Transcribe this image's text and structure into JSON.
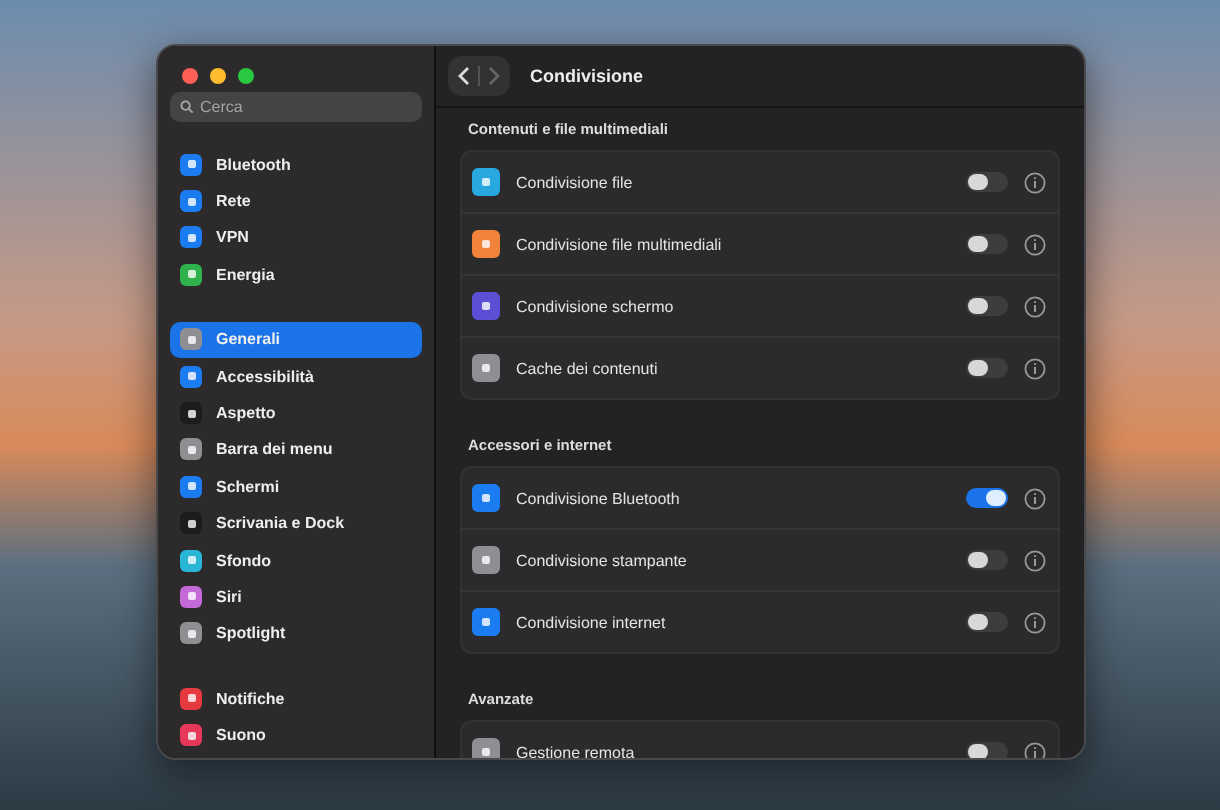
{
  "sidebar": {
    "search": {
      "placeholder": "Cerca"
    },
    "groups": [
      {
        "items": [
          {
            "label": "Bluetooth",
            "color": "#1a7cf0",
            "selected": false
          },
          {
            "label": "Rete",
            "color": "#1a7cf0",
            "selected": false
          },
          {
            "label": "VPN",
            "color": "#1a7cf0",
            "selected": false
          },
          {
            "label": "Energia",
            "color": "#2fb24c",
            "selected": false
          }
        ]
      },
      {
        "items": [
          {
            "label": "Generali",
            "color": "#8e8e93",
            "selected": true
          },
          {
            "label": "Accessibilità",
            "color": "#1a7cf0",
            "selected": false
          },
          {
            "label": "Aspetto",
            "color": "#1c1c1e",
            "selected": false
          },
          {
            "label": "Barra dei menu",
            "color": "#8e8e93",
            "selected": false
          },
          {
            "label": "Schermi",
            "color": "#1a7cf0",
            "selected": false
          },
          {
            "label": "Scrivania e Dock",
            "color": "#1c1c1e",
            "selected": false
          },
          {
            "label": "Sfondo",
            "color": "#2bb6d8",
            "selected": false
          },
          {
            "label": "Siri",
            "color": "#c46ad8",
            "selected": false
          },
          {
            "label": "Spotlight",
            "color": "#8e8e93",
            "selected": false
          }
        ]
      },
      {
        "items": [
          {
            "label": "Notifiche",
            "color": "#e5383f",
            "selected": false
          },
          {
            "label": "Suono",
            "color": "#e5385a",
            "selected": false
          }
        ]
      }
    ]
  },
  "header": {
    "title": "Condivisione"
  },
  "sections": [
    {
      "title": "Contenuti e file multimediali",
      "rows": [
        {
          "label": "Condivisione file",
          "color": "#27a9e0",
          "on": false
        },
        {
          "label": "Condivisione file multimediali",
          "color": "#f0823a",
          "on": false
        },
        {
          "label": "Condivisione schermo",
          "color": "#5b4fd6",
          "on": false
        },
        {
          "label": "Cache dei contenuti",
          "color": "#8e8e93",
          "on": false
        }
      ]
    },
    {
      "title": "Accessori e internet",
      "rows": [
        {
          "label": "Condivisione Bluetooth",
          "color": "#1a7cf0",
          "on": true
        },
        {
          "label": "Condivisione stampante",
          "color": "#8e8e93",
          "on": false
        },
        {
          "label": "Condivisione internet",
          "color": "#1a7cf0",
          "on": false
        }
      ]
    },
    {
      "title": "Avanzate",
      "rows": [
        {
          "label": "Gestione remota",
          "color": "#8e8e93",
          "on": false
        }
      ]
    }
  ]
}
